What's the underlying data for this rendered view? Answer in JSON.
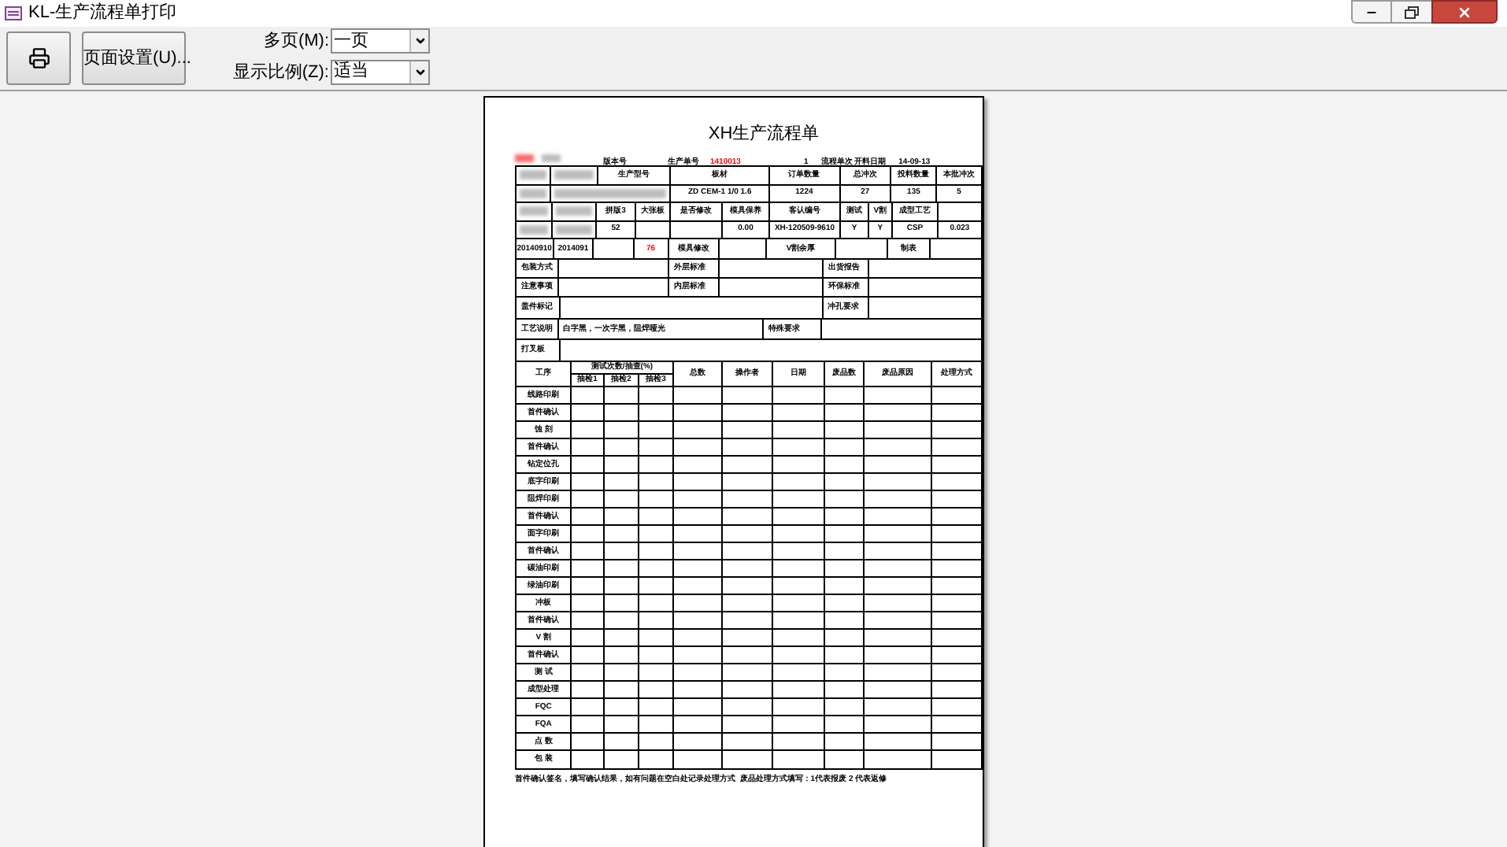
{
  "window": {
    "title": "KL-生产流程单打印"
  },
  "toolbar": {
    "page_setup_button": "页面设置(U)...",
    "fields": [
      {
        "label": "多页(M):",
        "value": "一页"
      },
      {
        "label": "显示比例(Z):",
        "value": "适当"
      }
    ]
  },
  "document": {
    "title": "XH生产流程单",
    "header_line": [
      {
        "redacted": true,
        "emphasis": true
      },
      {
        "redacted": true,
        "emphasis": false
      },
      {
        "text": "版本号",
        "redacted": false,
        "emphasis": false
      },
      {
        "text": "生产单号",
        "redacted": false,
        "emphasis": false
      },
      {
        "text": "1410013",
        "redacted": false,
        "emphasis": true
      },
      {
        "text": "1",
        "redacted": false,
        "emphasis": false
      },
      {
        "text": "流程单次 开料日期",
        "redacted": false,
        "emphasis": false
      },
      {
        "text": "14-09-13",
        "redacted": false,
        "emphasis": false
      }
    ],
    "info_rows": [
      [
        {
          "redacted": true
        },
        {
          "redacted": true
        },
        {
          "text": "生产型号"
        },
        {
          "text": "板材"
        },
        {
          "text": "订单数量"
        },
        {
          "text": "总冲次"
        },
        {
          "text": "投料数量"
        },
        {
          "text": "本批冲次"
        }
      ],
      [
        {
          "redacted": true
        },
        {
          "redacted": true
        },
        {
          "text": "ZD CEM-1 1/0 1.6"
        },
        {
          "text": "1224"
        },
        {
          "text": "27"
        },
        {
          "text": "135"
        },
        {
          "text": "5"
        }
      ],
      [
        {
          "redacted": true
        },
        {
          "redacted": true
        },
        {
          "text": "拼版3"
        },
        {
          "text": "大张板"
        },
        {
          "text": "是否修改"
        },
        {
          "text": "模具保养"
        },
        {
          "text": "客认编号"
        },
        {
          "text": "测试"
        },
        {
          "text": "V割"
        },
        {
          "text": "成型工艺"
        },
        {}
      ],
      [
        {
          "redacted": true
        },
        {
          "redacted": true
        },
        {
          "text": "52"
        },
        {},
        {},
        {
          "text": "0.00"
        },
        {
          "text": "XH-120509-9610"
        },
        {
          "text": "Y"
        },
        {
          "text": "Y"
        },
        {
          "text": "CSP"
        },
        {
          "text": "0.023"
        }
      ],
      [
        {
          "text": "20140910"
        },
        {
          "text": "2014091"
        },
        {},
        {
          "text": "76",
          "emphasis": true
        },
        {
          "text": "模具修改"
        },
        {},
        {
          "text": "V割余厚"
        },
        {},
        {
          "text": "制表"
        },
        {}
      ]
    ],
    "form_rows": [
      [
        "包装方式",
        null,
        "外层标准",
        null,
        "出货报告",
        null
      ],
      [
        "注意事项",
        null,
        "内层标准",
        null,
        "环保标准",
        null
      ],
      [
        "盖件标记",
        null,
        "冲孔要求",
        null
      ],
      [
        "工艺说明",
        "白字黑，一次字黑，阻焊哑光",
        "特殊要求",
        null
      ],
      [
        "打叉板",
        null
      ]
    ],
    "process_table": {
      "columns": [
        "工序",
        "抽检1",
        "抽检2",
        "抽检3",
        "总数",
        "操作者",
        "日期",
        "废品数",
        "废品原因",
        "处理方式"
      ],
      "group_header": "测试次数/抽查(%)",
      "rows": [
        "线路印刷",
        "首件确认",
        "蚀 刻",
        "首件确认",
        "钻定位孔",
        "底字印刷",
        "阻焊印刷",
        "首件确认",
        "面字印刷",
        "首件确认",
        "碳油印刷",
        "绿油印刷",
        "冲板",
        "首件确认",
        "V 割",
        "首件确认",
        "测 试",
        "成型处理",
        "FQC",
        "FQA",
        "点 数",
        "包 装"
      ]
    },
    "footer_note": "首件确认签名，填写确认结果，如有问题在空白处记录处理方式  废品处理方式填写：1代表报废 2 代表返修"
  }
}
